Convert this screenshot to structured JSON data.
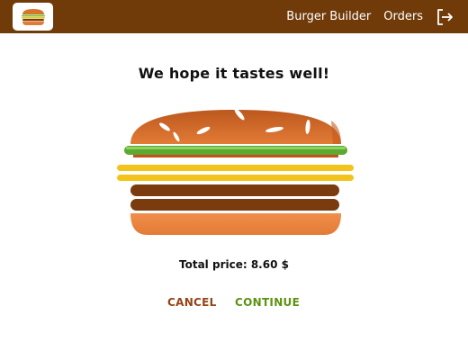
{
  "header": {
    "logo_icon": "burger-logo-icon",
    "nav": [
      {
        "label": "Burger Builder"
      },
      {
        "label": "Orders"
      }
    ],
    "logout_icon": "logout-icon",
    "background_color": "#703B09"
  },
  "summary": {
    "title": "We hope it tastes well!",
    "ingredients": [
      "salad",
      "cheese",
      "cheese",
      "meat",
      "meat"
    ],
    "total_price": "Total price: 8.60 $",
    "cancel_label": "CANCEL",
    "continue_label": "CONTINUE",
    "cancel_color": "#944317",
    "continue_color": "#5C9210"
  }
}
